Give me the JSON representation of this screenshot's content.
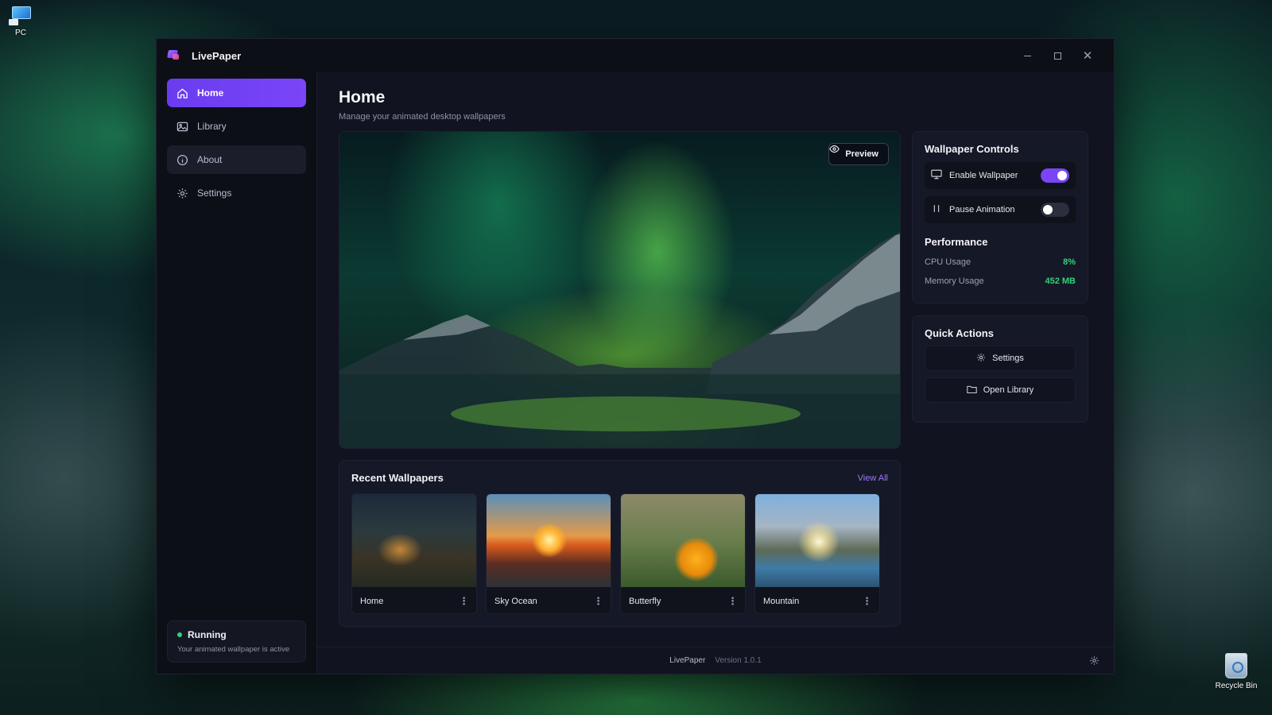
{
  "desktop": {
    "pc_label": "PC",
    "recycle_label": "Recycle Bin"
  },
  "window": {
    "title": "LivePaper"
  },
  "sidebar": {
    "items": [
      {
        "label": "Home",
        "icon": "home-icon"
      },
      {
        "label": "Library",
        "icon": "image-icon"
      },
      {
        "label": "About",
        "icon": "info-icon"
      },
      {
        "label": "Settings",
        "icon": "gear-icon"
      }
    ],
    "status": {
      "label": "Running",
      "detail": "Your animated wallpaper is active"
    }
  },
  "main": {
    "title": "Home",
    "subtitle": "Manage your animated desktop wallpapers",
    "preview_label": "Preview"
  },
  "controls": {
    "title": "Wallpaper Controls",
    "enable_label": "Enable Wallpaper",
    "enable_on": true,
    "pause_label": "Pause Animation",
    "pause_on": false,
    "performance_title": "Performance",
    "cpu_label": "CPU Usage",
    "cpu_value": "8%",
    "memory_label": "Memory Usage",
    "memory_value": "452 MB"
  },
  "quick_actions": {
    "title": "Quick Actions",
    "settings_label": "Settings",
    "library_label": "Open Library"
  },
  "recent": {
    "title": "Recent Wallpapers",
    "view_all": "View All",
    "items": [
      {
        "name": "Home"
      },
      {
        "name": "Sky Ocean"
      },
      {
        "name": "Butterfly"
      },
      {
        "name": "Mountain"
      }
    ]
  },
  "footer": {
    "app": "LivePaper",
    "version": "Version 1.0.1"
  },
  "colors": {
    "accent": "#7a45f7",
    "success": "#2fd479"
  }
}
